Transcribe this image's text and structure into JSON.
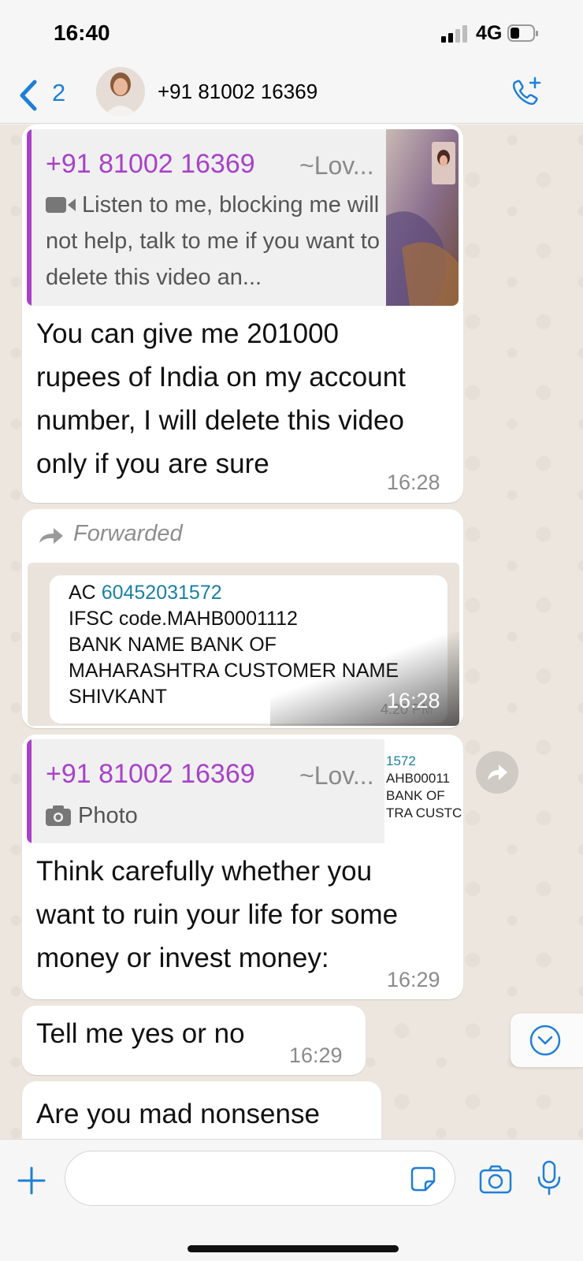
{
  "status_bar": {
    "time": "16:40",
    "network": "4G"
  },
  "header": {
    "back_count": "2",
    "contact_name": "+91 81002 16369"
  },
  "messages": [
    {
      "quote": {
        "name": "+91 81002 16369",
        "alias": "~Lov...",
        "text": "Listen to me, blocking me will not help, talk to me if you want to delete this video an...",
        "type": "video"
      },
      "text_lines": [
        "You can give me 201000",
        "rupees of India on my account",
        "number, I will delete this video",
        "only if you are sure"
      ],
      "time": "16:28"
    },
    {
      "forwarded_label": "Forwarded",
      "image_text": {
        "ac_prefix": "AC ",
        "ac_number": "60452031572",
        "line2": "IFSC code.MAHB0001112",
        "line3": "BANK NAME BANK OF",
        "line4": "MAHARASHTRA CUSTOMER NAME",
        "line5": "SHIVKANT",
        "ghost_time": "4:20 PM"
      },
      "time": "16:28"
    },
    {
      "quote": {
        "name": "+91 81002 16369",
        "alias": "~Lov...",
        "text": "Photo",
        "type": "photo"
      },
      "thumb_lines": [
        "1572",
        "AHB00011",
        "BANK OF",
        "TRA CUSTC"
      ],
      "text_lines": [
        "Think carefully whether you",
        "want to ruin your life for some",
        "money or invest money:"
      ],
      "time": "16:29"
    },
    {
      "text_lines": [
        "Tell me yes or no"
      ],
      "time": "16:29"
    },
    {
      "text_lines": [
        "Are you mad nonsense"
      ]
    }
  ],
  "composer": {
    "placeholder": ""
  },
  "colors": {
    "accent": "#1f7fd6",
    "quote_name": "#a742c8",
    "bubble": "#ffffff",
    "chat_bg": "#ece6de"
  }
}
